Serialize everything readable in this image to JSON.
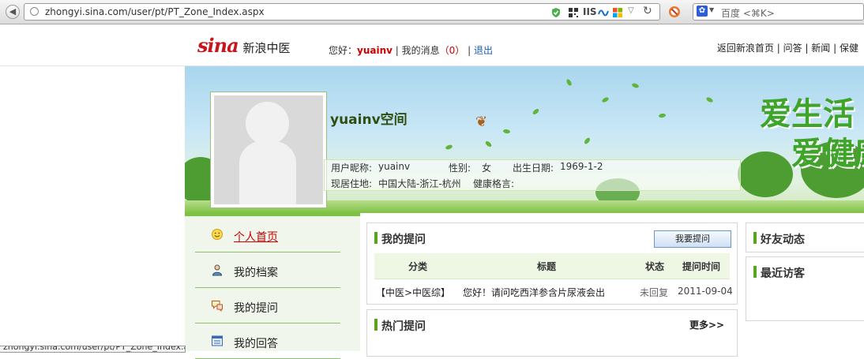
{
  "browser": {
    "url": "zhongyi.sina.com/user/pt/PT_Zone_Index.aspx",
    "search_placeholder": "百度 <⌘K>",
    "status_url": "zhongyi.sina.com/user/pt/PT_Zone_Index.aspx"
  },
  "header": {
    "logo_text": "sina",
    "logo_sub": "新浪中医",
    "greeting_prefix": "您好：",
    "username": "yuainv",
    "sep1": " | ",
    "messages_label": "我的消息",
    "message_count": "（0）",
    "sep2": " | ",
    "logout_label": "退出",
    "top_links": [
      "返回新浪首页",
      "问答",
      "新闻",
      "保健"
    ]
  },
  "profile": {
    "space_title": "yuainv空间",
    "nickname_label": "用户昵称:",
    "nickname": "yuainv",
    "gender_label": "性别:",
    "gender": "女",
    "birth_label": "出生日期:",
    "birth": "1969-1-2",
    "location_label": "现居住地:",
    "location": "中国大陆-浙江-杭州",
    "motto_label": "健康格言:",
    "motto": ""
  },
  "banner": {
    "slogan_1": "爱生活",
    "slogan_2": "爱健康"
  },
  "nav": {
    "items": [
      {
        "label": "个人首页",
        "icon": "smiley-icon"
      },
      {
        "label": "我的档案",
        "icon": "user-profile-icon"
      },
      {
        "label": "我的提问",
        "icon": "speech-bubble-icon"
      },
      {
        "label": "我的回答",
        "icon": "document-list-icon"
      }
    ]
  },
  "questions": {
    "title": "我的提问",
    "ask_button": "我要提问",
    "columns": [
      "分类",
      "标题",
      "状态",
      "提问时间"
    ],
    "rows": [
      {
        "category": "【中医>中医综】",
        "title": "您好！请问吃西洋参含片尿液会出",
        "status": "未回复",
        "date": "2011-09-04"
      }
    ]
  },
  "hot": {
    "title": "热门提问",
    "more": "更多>>"
  },
  "friends": {
    "title": "好友动态"
  },
  "visitors": {
    "title": "最近访客"
  },
  "colors": {
    "accent_green": "#7cc242",
    "brand_red": "#c8161d",
    "link_blue": "#1a5fb4"
  }
}
